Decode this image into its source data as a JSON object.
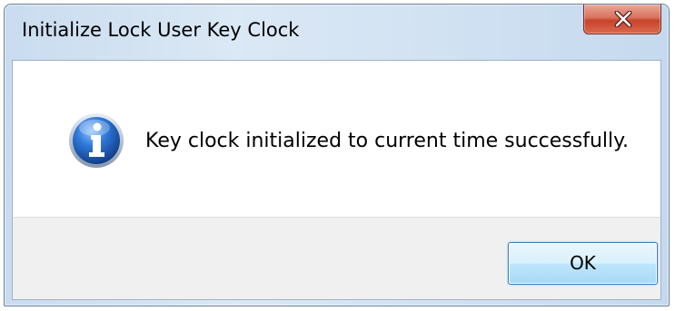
{
  "window": {
    "title": "Initialize Lock User Key Clock"
  },
  "dialog": {
    "icon": "information-icon",
    "message": "Key clock initialized to current time successfully.",
    "ok_label": "OK"
  },
  "titlebar": {
    "close_icon": "close-icon"
  },
  "colors": {
    "close_button": "#c8432a",
    "info_icon_blue": "#1f5fbf",
    "ok_button_border": "#3c7fb1",
    "button_area_bg": "#f0f0f0"
  }
}
